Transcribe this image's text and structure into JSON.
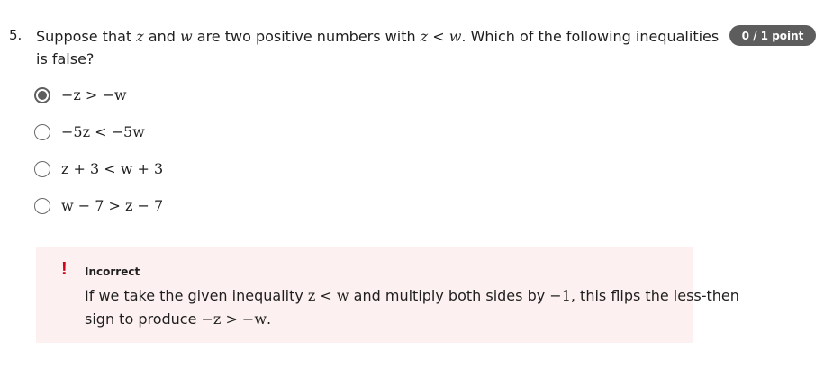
{
  "question": {
    "number": "5.",
    "text_before_z": "Suppose that ",
    "var_z": "z",
    "text_and": " and ",
    "var_w": "w",
    "text_mid": " are two positive numbers with ",
    "ineq_lhs": "z",
    "ineq_op": " < ",
    "ineq_rhs": "w",
    "text_after": ". Which of the following inequalities is false?",
    "points": "0 / 1 point"
  },
  "options": [
    {
      "label": "−z > −w",
      "selected": true
    },
    {
      "label": "−5z < −5w",
      "selected": false
    },
    {
      "label": "z + 3 < w + 3",
      "selected": false
    },
    {
      "label": "w − 7 > z − 7",
      "selected": false
    }
  ],
  "feedback": {
    "icon": "!",
    "icon_name": "exclamation-icon",
    "title": "Incorrect",
    "body_part1": "If we take the given inequality ",
    "body_math1": "z < w",
    "body_part2": " and multiply both sides by ",
    "body_math2": "−1",
    "body_part3": ", this flips the less-then sign to produce ",
    "body_math3": "−z > −w",
    "body_part4": "."
  },
  "colors": {
    "badge_bg": "#5d5d5d",
    "feedback_bg": "#fdf0f0",
    "error_red": "#d0021b"
  }
}
